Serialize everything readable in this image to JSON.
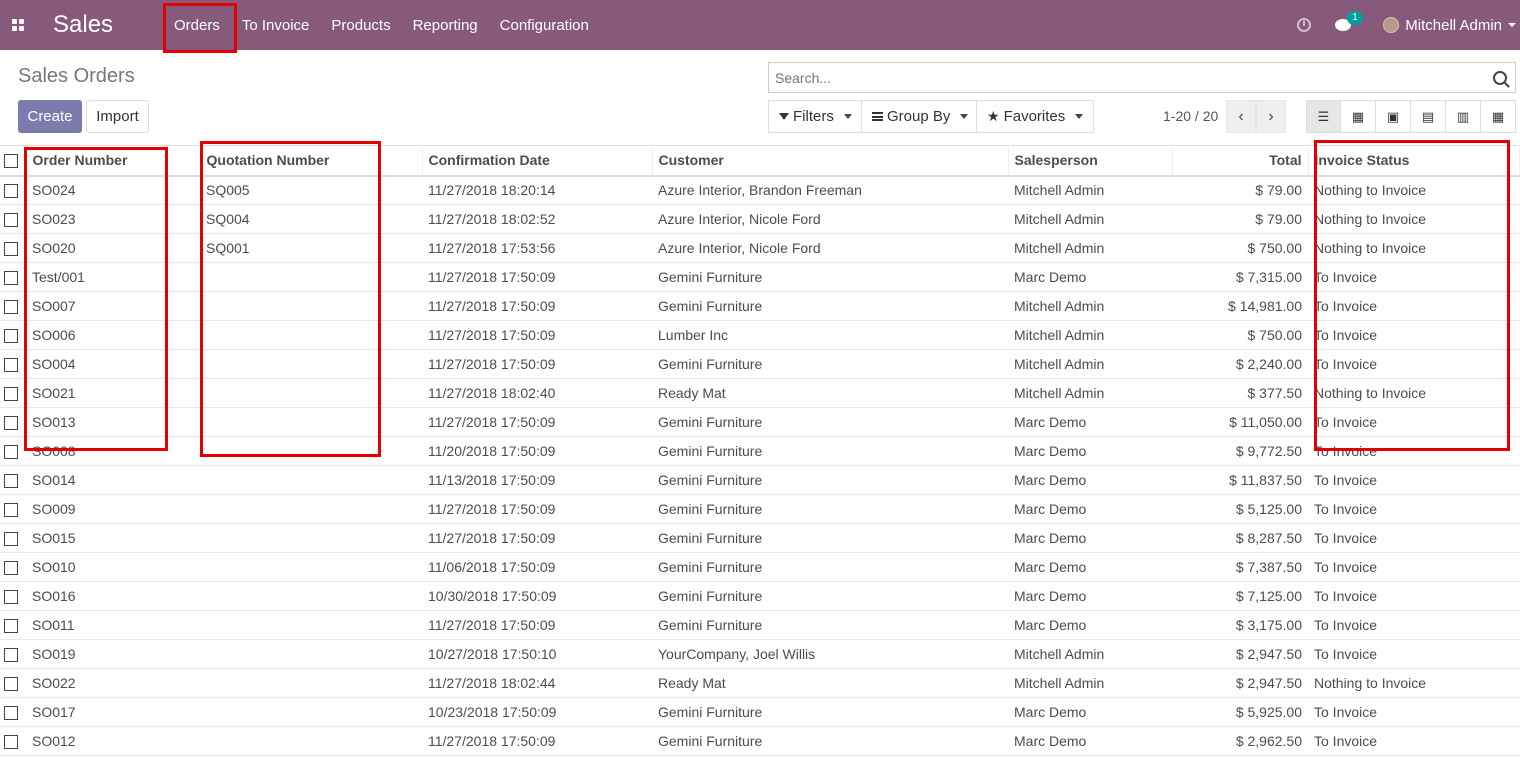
{
  "navbar": {
    "app_name": "Sales",
    "menu": [
      "Orders",
      "To Invoice",
      "Products",
      "Reporting",
      "Configuration"
    ],
    "chat_badge": "1",
    "user_name": "Mitchell Admin"
  },
  "control_panel": {
    "title": "Sales Orders",
    "create_label": "Create",
    "import_label": "Import",
    "search_placeholder": "Search...",
    "filters_label": "Filters",
    "group_by_label": "Group By",
    "favorites_label": "Favorites",
    "pager": "1-20 / 20"
  },
  "table": {
    "headers": [
      "Order Number",
      "Quotation Number",
      "Confirmation Date",
      "Customer",
      "Salesperson",
      "Total",
      "Invoice Status"
    ],
    "rows": [
      [
        "SO024",
        "SQ005",
        "11/27/2018 18:20:14",
        "Azure Interior, Brandon Freeman",
        "Mitchell Admin",
        "$ 79.00",
        "Nothing to Invoice"
      ],
      [
        "SO023",
        "SQ004",
        "11/27/2018 18:02:52",
        "Azure Interior, Nicole Ford",
        "Mitchell Admin",
        "$ 79.00",
        "Nothing to Invoice"
      ],
      [
        "SO020",
        "SQ001",
        "11/27/2018 17:53:56",
        "Azure Interior, Nicole Ford",
        "Mitchell Admin",
        "$ 750.00",
        "Nothing to Invoice"
      ],
      [
        "Test/001",
        "",
        "11/27/2018 17:50:09",
        "Gemini Furniture",
        "Marc Demo",
        "$ 7,315.00",
        "To Invoice"
      ],
      [
        "SO007",
        "",
        "11/27/2018 17:50:09",
        "Gemini Furniture",
        "Mitchell Admin",
        "$ 14,981.00",
        "To Invoice"
      ],
      [
        "SO006",
        "",
        "11/27/2018 17:50:09",
        "Lumber Inc",
        "Mitchell Admin",
        "$ 750.00",
        "To Invoice"
      ],
      [
        "SO004",
        "",
        "11/27/2018 17:50:09",
        "Gemini Furniture",
        "Mitchell Admin",
        "$ 2,240.00",
        "To Invoice"
      ],
      [
        "SO021",
        "",
        "11/27/2018 18:02:40",
        "Ready Mat",
        "Mitchell Admin",
        "$ 377.50",
        "Nothing to Invoice"
      ],
      [
        "SO013",
        "",
        "11/27/2018 17:50:09",
        "Gemini Furniture",
        "Marc Demo",
        "$ 11,050.00",
        "To Invoice"
      ],
      [
        "SO008",
        "",
        "11/20/2018 17:50:09",
        "Gemini Furniture",
        "Marc Demo",
        "$ 9,772.50",
        "To Invoice"
      ],
      [
        "SO014",
        "",
        "11/13/2018 17:50:09",
        "Gemini Furniture",
        "Marc Demo",
        "$ 11,837.50",
        "To Invoice"
      ],
      [
        "SO009",
        "",
        "11/27/2018 17:50:09",
        "Gemini Furniture",
        "Marc Demo",
        "$ 5,125.00",
        "To Invoice"
      ],
      [
        "SO015",
        "",
        "11/27/2018 17:50:09",
        "Gemini Furniture",
        "Marc Demo",
        "$ 8,287.50",
        "To Invoice"
      ],
      [
        "SO010",
        "",
        "11/06/2018 17:50:09",
        "Gemini Furniture",
        "Marc Demo",
        "$ 7,387.50",
        "To Invoice"
      ],
      [
        "SO016",
        "",
        "10/30/2018 17:50:09",
        "Gemini Furniture",
        "Marc Demo",
        "$ 7,125.00",
        "To Invoice"
      ],
      [
        "SO011",
        "",
        "11/27/2018 17:50:09",
        "Gemini Furniture",
        "Marc Demo",
        "$ 3,175.00",
        "To Invoice"
      ],
      [
        "SO019",
        "",
        "10/27/2018 17:50:10",
        "YourCompany, Joel Willis",
        "Mitchell Admin",
        "$ 2,947.50",
        "To Invoice"
      ],
      [
        "SO022",
        "",
        "11/27/2018 18:02:44",
        "Ready Mat",
        "Mitchell Admin",
        "$ 2,947.50",
        "Nothing to Invoice"
      ],
      [
        "SO017",
        "",
        "10/23/2018 17:50:09",
        "Gemini Furniture",
        "Marc Demo",
        "$ 5,925.00",
        "To Invoice"
      ],
      [
        "SO012",
        "",
        "11/27/2018 17:50:09",
        "Gemini Furniture",
        "Marc Demo",
        "$ 2,962.50",
        "To Invoice"
      ]
    ]
  },
  "colors": {
    "navbar": "#875a7b",
    "primary_button": "#7c7bad",
    "highlight": "#e50000"
  }
}
